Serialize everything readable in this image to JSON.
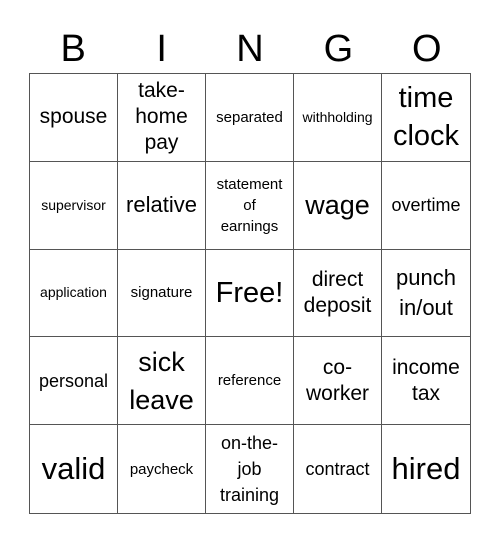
{
  "header": [
    "B",
    "I",
    "N",
    "G",
    "O"
  ],
  "cells": [
    "spouse",
    "take-\nhome\npay",
    "separated",
    "withholding",
    "time\nclock",
    "supervisor",
    "relative",
    "statement\nof\nearnings",
    "wage",
    "overtime",
    "application",
    "signature",
    "Free!",
    "direct\ndeposit",
    "punch\nin/out",
    "personal",
    "sick\nleave",
    "reference",
    "co-\nworker",
    "income\ntax",
    "valid",
    "paycheck",
    "on-the-\njob\ntraining",
    "contract",
    "hired"
  ]
}
